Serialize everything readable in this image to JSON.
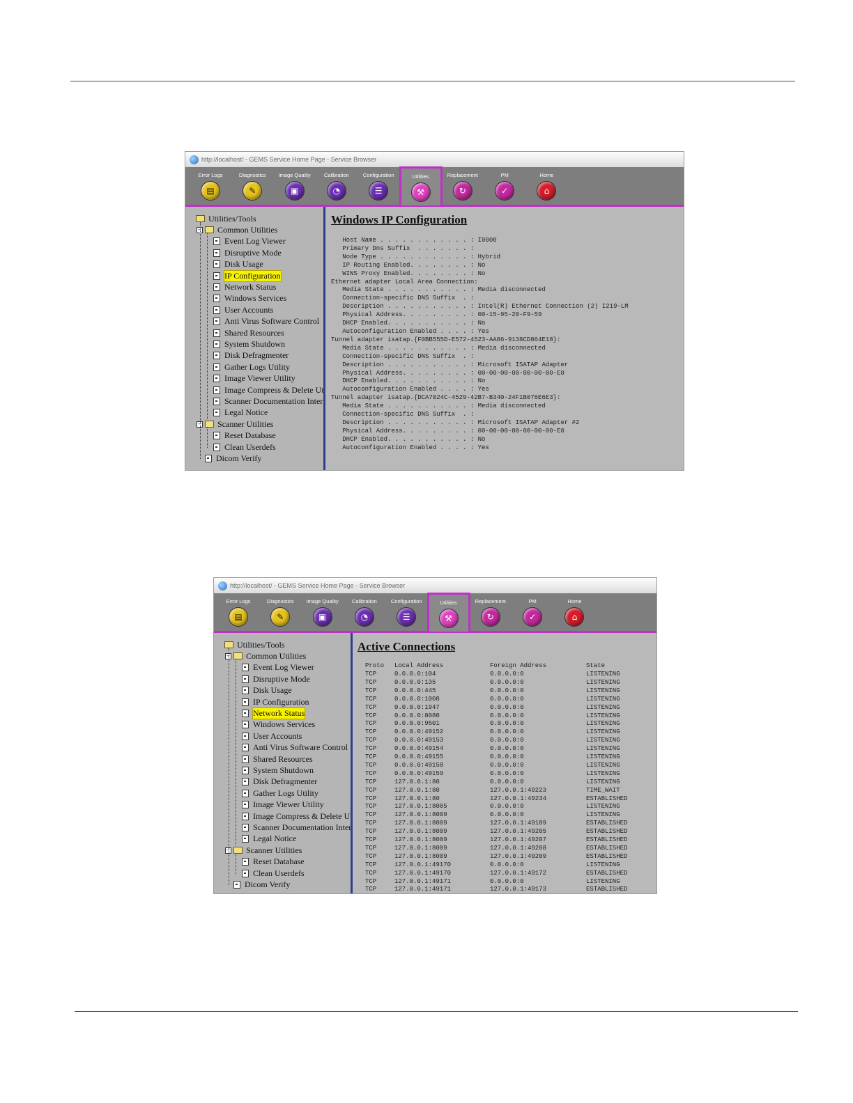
{
  "screenshot1": {
    "window_title": "http://localhost/ - GEMS Service Home Page - Service Browser",
    "toolbar": [
      {
        "label": "Error Logs",
        "icon": "error-logs-icon",
        "glyph": "▤",
        "color": "yellow"
      },
      {
        "label": "Diagnostics",
        "icon": "diagnostics-icon",
        "glyph": "✎",
        "color": "yellow"
      },
      {
        "label": "Image Quality",
        "icon": "image-quality-icon",
        "glyph": "▣",
        "color": "purple"
      },
      {
        "label": "Calibration",
        "icon": "calibration-icon",
        "glyph": "◔",
        "color": "purple"
      },
      {
        "label": "Configuration",
        "icon": "configuration-icon",
        "glyph": "☰",
        "color": "purple"
      },
      {
        "label": "Utilities",
        "icon": "utilities-icon",
        "glyph": "⚒",
        "color": "pink",
        "active": true
      },
      {
        "label": "Replacement",
        "icon": "replacement-icon",
        "glyph": "↻",
        "color": "magenta"
      },
      {
        "label": "PM",
        "icon": "pm-icon",
        "glyph": "✓",
        "color": "magenta"
      },
      {
        "label": "Home",
        "icon": "home-icon",
        "glyph": "⌂",
        "color": "red"
      }
    ],
    "tree": {
      "root": "Utilities/Tools",
      "group1": "Common Utilities",
      "items1": [
        "Event Log Viewer",
        "Disruptive Mode",
        "Disk Usage",
        "IP Configuration",
        "Network Status",
        "Windows Services",
        "User Accounts",
        "Anti Virus Software Control",
        "Shared Resources",
        "System Shutdown",
        "Disk Defragmenter",
        "Gather Logs Utility",
        "Image Viewer Utility",
        "Image Compress & Delete Util",
        "Scanner Documentation Interfa",
        "Legal Notice"
      ],
      "group2": "Scanner Utilities",
      "items2": [
        "Reset Database",
        "Clean Userdefs"
      ],
      "last": "Dicom Verify",
      "selected": "IP Configuration"
    },
    "content_title": "Windows IP Configuration",
    "ip_lines": [
      "   Host Name . . . . . . . . . . . . : I0000",
      "   Primary Dns Suffix  . . . . . . . :",
      "   Node Type . . . . . . . . . . . . : Hybrid",
      "   IP Routing Enabled. . . . . . . . : No",
      "   WINS Proxy Enabled. . . . . . . . : No",
      "Ethernet adapter Local Area Connection:",
      "   Media State . . . . . . . . . . . : Media disconnected",
      "   Connection-specific DNS Suffix  . :",
      "   Description . . . . . . . . . . . : Intel(R) Ethernet Connection (2) I219-LM",
      "   Physical Address. . . . . . . . . : 00-15-95-20-F9-59",
      "   DHCP Enabled. . . . . . . . . . . : No",
      "   Autoconfiguration Enabled . . . . : Yes",
      "Tunnel adapter isatap.{F0BB555D-E572-4523-AA86-9138CD864E18}:",
      "   Media State . . . . . . . . . . . : Media disconnected",
      "   Connection-specific DNS Suffix  . :",
      "   Description . . . . . . . . . . . : Microsoft ISATAP Adapter",
      "   Physical Address. . . . . . . . . : 00-00-00-00-00-00-00-E0",
      "   DHCP Enabled. . . . . . . . . . . : No",
      "   Autoconfiguration Enabled . . . . : Yes",
      "Tunnel adapter isatap.{DCA7024C-4529-42B7-B340-24F1B076E6E3}:",
      "   Media State . . . . . . . . . . . : Media disconnected",
      "   Connection-specific DNS Suffix  . :",
      "   Description . . . . . . . . . . . : Microsoft ISATAP Adapter #2",
      "   Physical Address. . . . . . . . . : 00-00-00-00-00-00-00-E0",
      "   DHCP Enabled. . . . . . . . . . . : No",
      "   Autoconfiguration Enabled . . . . : Yes"
    ]
  },
  "screenshot2": {
    "window_title": "http://localhost/ - GEMS Service Home Page - Service Browser",
    "selected": "Network Status",
    "content_title": "Active Connections",
    "headers": [
      "Proto",
      "Local Address",
      "Foreign Address",
      "State"
    ],
    "rows": [
      [
        "TCP",
        "0.0.0.0:104",
        "0.0.0.0:0",
        "LISTENING"
      ],
      [
        "TCP",
        "0.0.0.0:135",
        "0.0.0.0:0",
        "LISTENING"
      ],
      [
        "TCP",
        "0.0.0.0:445",
        "0.0.0.0:0",
        "LISTENING"
      ],
      [
        "TCP",
        "0.0.0.0:1008",
        "0.0.0.0:0",
        "LISTENING"
      ],
      [
        "TCP",
        "0.0.0.0:1947",
        "0.0.0.0:0",
        "LISTENING"
      ],
      [
        "TCP",
        "0.0.0.0:8080",
        "0.0.0.0:0",
        "LISTENING"
      ],
      [
        "TCP",
        "0.0.0.0:9501",
        "0.0.0.0:0",
        "LISTENING"
      ],
      [
        "TCP",
        "0.0.0.0:49152",
        "0.0.0.0:0",
        "LISTENING"
      ],
      [
        "TCP",
        "0.0.0.0:49153",
        "0.0.0.0:0",
        "LISTENING"
      ],
      [
        "TCP",
        "0.0.0.0:49154",
        "0.0.0.0:0",
        "LISTENING"
      ],
      [
        "TCP",
        "0.0.0.0:49155",
        "0.0.0.0:0",
        "LISTENING"
      ],
      [
        "TCP",
        "0.0.0.0:49158",
        "0.0.0.0:0",
        "LISTENING"
      ],
      [
        "TCP",
        "0.0.0.0:49159",
        "0.0.0.0:0",
        "LISTENING"
      ],
      [
        "TCP",
        "127.0.0.1:80",
        "0.0.0.0:0",
        "LISTENING"
      ],
      [
        "TCP",
        "127.0.0.1:80",
        "127.0.0.1:49223",
        "TIME_WAIT"
      ],
      [
        "TCP",
        "127.0.0.1:80",
        "127.0.0.1:49234",
        "ESTABLISHED"
      ],
      [
        "TCP",
        "127.0.0.1:8005",
        "0.0.0.0:0",
        "LISTENING"
      ],
      [
        "TCP",
        "127.0.0.1:8009",
        "0.0.0.0:0",
        "LISTENING"
      ],
      [
        "TCP",
        "127.0.0.1:8009",
        "127.0.0.1:49189",
        "ESTABLISHED"
      ],
      [
        "TCP",
        "127.0.0.1:8009",
        "127.0.0.1:49205",
        "ESTABLISHED"
      ],
      [
        "TCP",
        "127.0.0.1:8009",
        "127.0.0.1:49207",
        "ESTABLISHED"
      ],
      [
        "TCP",
        "127.0.0.1:8009",
        "127.0.0.1:49208",
        "ESTABLISHED"
      ],
      [
        "TCP",
        "127.0.0.1:8009",
        "127.0.0.1:49209",
        "ESTABLISHED"
      ],
      [
        "TCP",
        "127.0.0.1:49170",
        "0.0.0.0:0",
        "LISTENING"
      ],
      [
        "TCP",
        "127.0.0.1:49170",
        "127.0.0.1:49172",
        "ESTABLISHED"
      ],
      [
        "TCP",
        "127.0.0.1:49171",
        "0.0.0.0:0",
        "LISTENING"
      ],
      [
        "TCP",
        "127.0.0.1:49171",
        "127.0.0.1:49173",
        "ESTABLISHED"
      ]
    ]
  }
}
